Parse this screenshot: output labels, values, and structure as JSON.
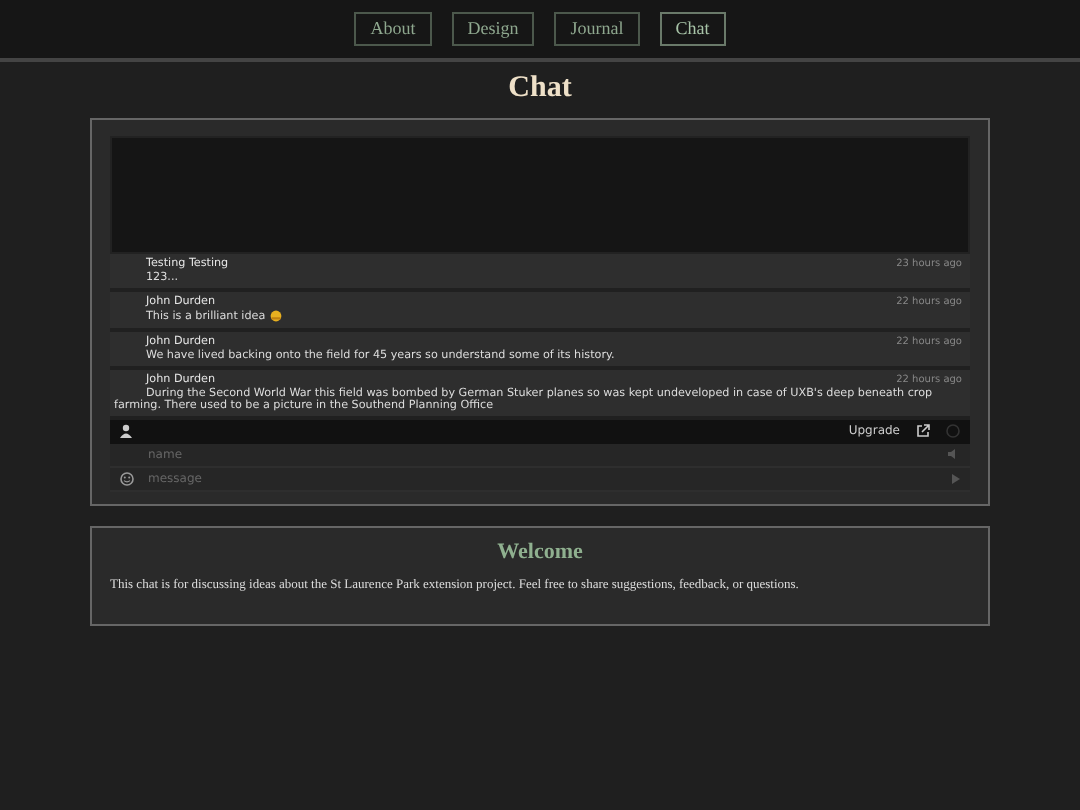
{
  "nav": [
    {
      "label": "About",
      "selected": false
    },
    {
      "label": "Design",
      "selected": false
    },
    {
      "label": "Journal",
      "selected": false
    },
    {
      "label": "Chat",
      "selected": true
    }
  ],
  "title": "Chat",
  "messages": [
    {
      "author": "Testing Testing",
      "time": "23 hours ago",
      "text": "123..."
    },
    {
      "author": "John Durden",
      "time": "22 hours ago",
      "text": "This is a brilliant idea",
      "emoji": true
    },
    {
      "author": "John Durden",
      "time": "22 hours ago",
      "text": "We have lived backing onto the field for 45 years so understand some of its history."
    },
    {
      "author": "John Durden",
      "time": "22 hours ago",
      "text": "During the Second World War this field was bombed by German Stuker planes so was kept undeveloped in case of UXB's deep beneath crop farming. There used to be a picture in the Southend Planning Office"
    }
  ],
  "toolbar": {
    "upgrade": "Upgrade"
  },
  "inputs": {
    "name_placeholder": "name",
    "message_placeholder": "message"
  },
  "welcome": {
    "title": "Welcome",
    "text": "This chat is for discussing ideas about the St Laurence Park extension project. Feel free to share suggestions, feedback, or questions."
  }
}
